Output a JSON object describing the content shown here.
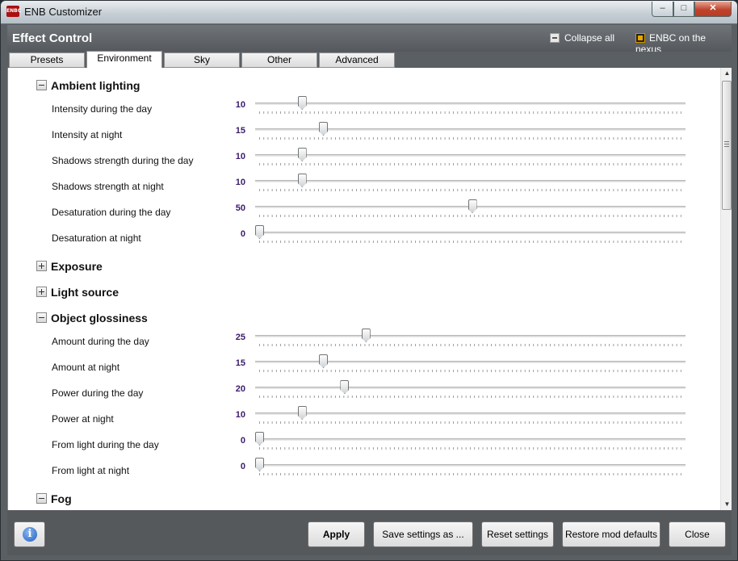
{
  "window": {
    "title": "ENB Customizer",
    "icon_text": "ENBC",
    "min_glyph": "–",
    "max_glyph": "□",
    "close_glyph": "✕"
  },
  "header": {
    "title": "Effect Control",
    "collapse_all": "Collapse all",
    "nexus_link": "ENBC on the nexus"
  },
  "tabs": [
    {
      "label": "Presets",
      "active": false
    },
    {
      "label": "Environment",
      "active": true
    },
    {
      "label": "Sky",
      "active": false
    },
    {
      "label": "Other",
      "active": false
    },
    {
      "label": "Advanced",
      "active": false
    }
  ],
  "slider_range": [
    0,
    100
  ],
  "sections": [
    {
      "title": "Ambient lighting",
      "expanded": true,
      "rows": [
        {
          "label": "Intensity during the day",
          "value": "10"
        },
        {
          "label": "Intensity at night",
          "value": "15"
        },
        {
          "label": "Shadows strength during the day",
          "value": "10"
        },
        {
          "label": "Shadows strength at night",
          "value": "10"
        },
        {
          "label": "Desaturation during the day",
          "value": "50"
        },
        {
          "label": "Desaturation at night",
          "value": "0"
        }
      ]
    },
    {
      "title": "Exposure",
      "expanded": false,
      "rows": []
    },
    {
      "title": "Light source",
      "expanded": false,
      "rows": []
    },
    {
      "title": "Object glossiness",
      "expanded": true,
      "rows": [
        {
          "label": "Amount during the day",
          "value": "25"
        },
        {
          "label": "Amount at night",
          "value": "15"
        },
        {
          "label": "Power during the day",
          "value": "20"
        },
        {
          "label": "Power at night",
          "value": "10"
        },
        {
          "label": "From light during the day",
          "value": "0"
        },
        {
          "label": "From light at night",
          "value": "0"
        }
      ]
    },
    {
      "title": "Fog",
      "expanded": true,
      "rows": []
    }
  ],
  "scrollbar": {
    "up_glyph": "▲",
    "down_glyph": "▼"
  },
  "footer": {
    "info_glyph": "i",
    "apply": "Apply",
    "save": "Save settings as ...",
    "reset": "Reset settings",
    "restore": "Restore mod defaults",
    "close": "Close"
  }
}
